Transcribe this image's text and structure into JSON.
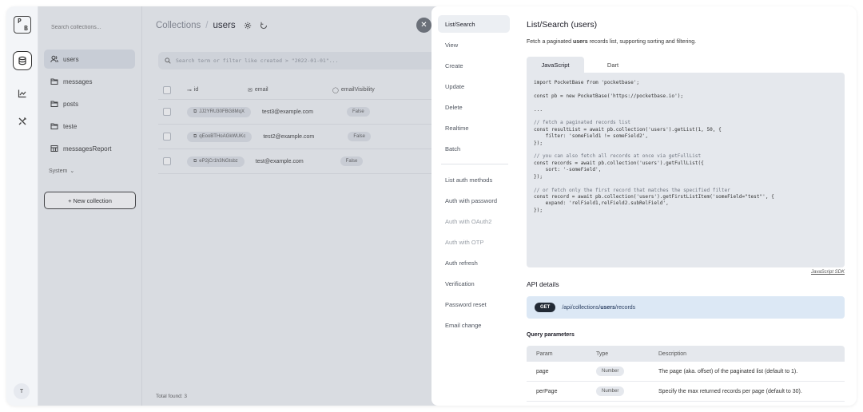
{
  "logo": {
    "p": "P",
    "b": "B"
  },
  "rail": {
    "avatar": "T"
  },
  "sidebar": {
    "search_placeholder": "Search collections...",
    "items": [
      {
        "label": "users",
        "icon": "users-icon"
      },
      {
        "label": "messages",
        "icon": "folder-icon"
      },
      {
        "label": "posts",
        "icon": "folder-icon"
      },
      {
        "label": "teste",
        "icon": "folder-icon"
      },
      {
        "label": "messagesReport",
        "icon": "table-view-icon"
      }
    ],
    "system_label": "System",
    "new_collection": "+ New collection"
  },
  "main": {
    "breadcrumb_root": "Collections",
    "breadcrumb_sep": "/",
    "breadcrumb_current": "users",
    "search_placeholder": "Search term or filter like created > \"2022-01-01\"...",
    "columns": {
      "id": "id",
      "email": "email",
      "email_visibility": "emailVisibility"
    },
    "rows": [
      {
        "id": "JJ2YRU30FBG8MqX",
        "email": "test3@example.com",
        "visibility": "False"
      },
      {
        "id": "qEooBTHoAGkWUKc",
        "email": "test2@example.com",
        "visibility": "False"
      },
      {
        "id": "eP2jCr1h3NGtsbz",
        "email": "test@example.com",
        "visibility": "False"
      }
    ],
    "total": "Total found: 3"
  },
  "panel": {
    "nav": [
      {
        "label": "List/Search",
        "active": true
      },
      {
        "label": "View"
      },
      {
        "label": "Create"
      },
      {
        "label": "Update"
      },
      {
        "label": "Delete"
      },
      {
        "label": "Realtime"
      },
      {
        "label": "Batch"
      }
    ],
    "nav_auth": [
      {
        "label": "List auth methods"
      },
      {
        "label": "Auth with password"
      },
      {
        "label": "Auth with OAuth2",
        "muted": true
      },
      {
        "label": "Auth with OTP",
        "muted": true
      },
      {
        "label": "Auth refresh"
      },
      {
        "label": "Verification"
      },
      {
        "label": "Password reset"
      },
      {
        "label": "Email change"
      }
    ],
    "title": "List/Search (users)",
    "desc_pre": "Fetch a paginated ",
    "desc_bold": "users",
    "desc_post": " records list, supporting sorting and filtering.",
    "tabs": [
      "JavaScript",
      "Dart"
    ],
    "code_lines": [
      "import PocketBase from 'pocketbase';",
      "",
      "const pb = new PocketBase('https://pocketbase.io');",
      "",
      "...",
      "",
      "// fetch a paginated records list",
      "const resultList = await pb.collection('users').getList(1, 50, {",
      "    filter: 'someField1 != someField2',",
      "});",
      "",
      "// you can also fetch all records at once via getFullList",
      "const records = await pb.collection('users').getFullList({",
      "    sort: '-someField',",
      "});",
      "",
      "// or fetch only the first record that matches the specified filter",
      "const record = await pb.collection('users').getFirstListItem('someField=\"test\"', {",
      "    expand: 'relField1,relField2.subRelField',",
      "});"
    ],
    "sdk_link": "JavaScript SDK",
    "api_details": "API details",
    "method": "GET",
    "path_pre": "/api/collections/",
    "path_bold": "users",
    "path_post": "/records",
    "query_params_title": "Query parameters",
    "qhead": {
      "param": "Param",
      "type": "Type",
      "desc": "Description"
    },
    "qrows": [
      {
        "param": "page",
        "type": "Number",
        "desc": "The page (aka. offset) of the paginated list (default to 1)."
      },
      {
        "param": "perPage",
        "type": "Number",
        "desc": "Specify the max returned records per page (default to 30)."
      }
    ]
  }
}
